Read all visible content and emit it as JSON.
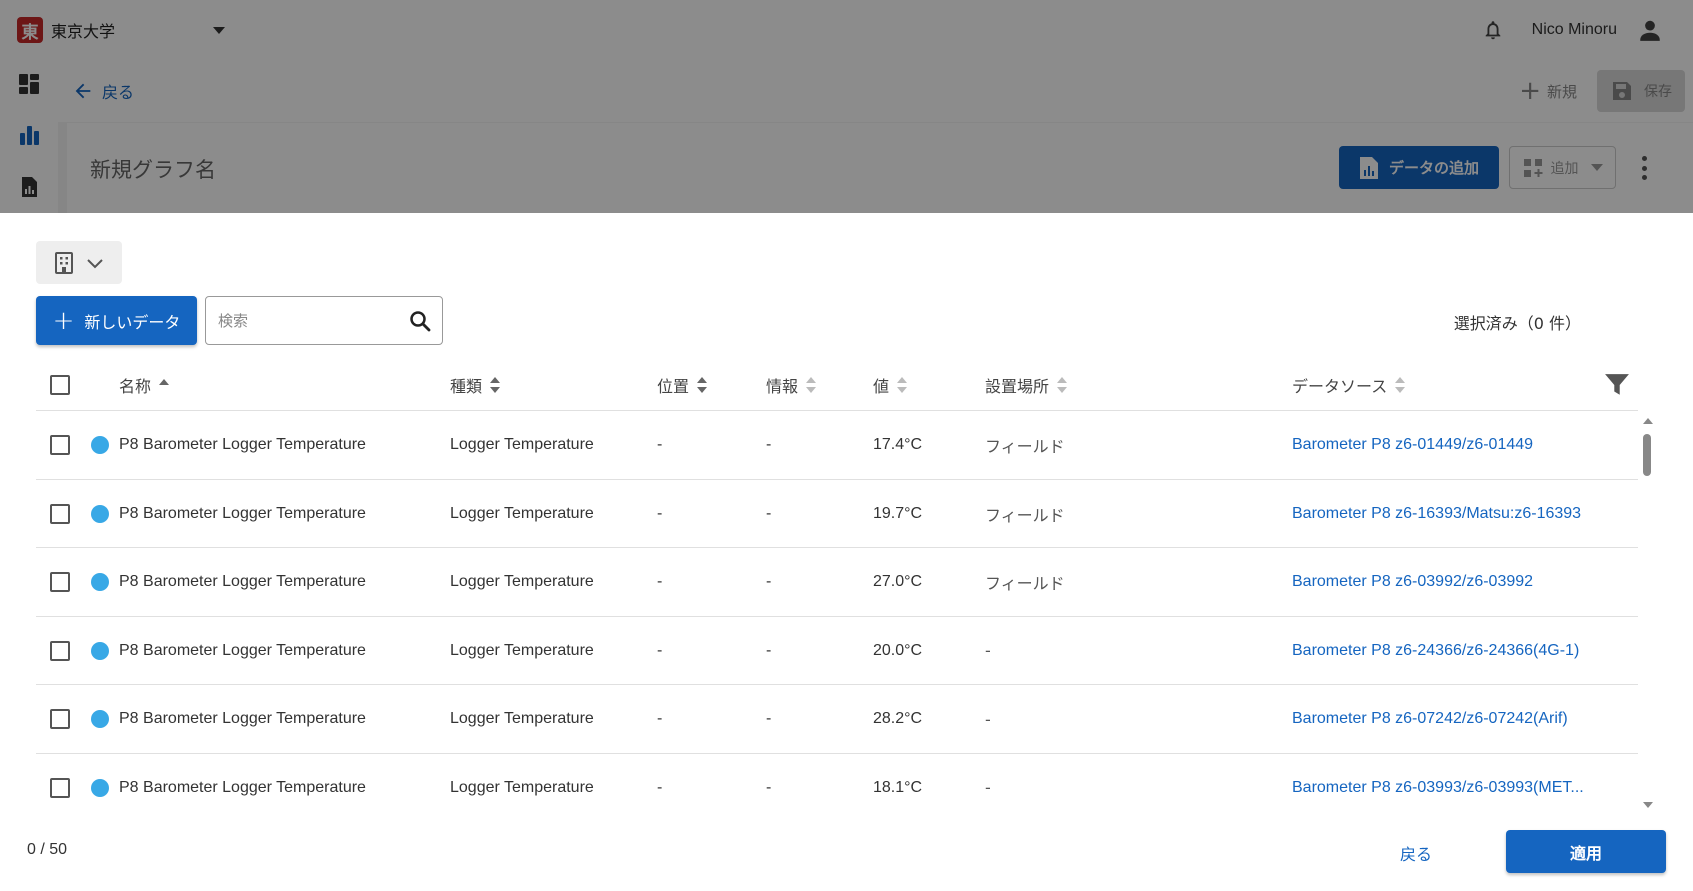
{
  "app": {
    "logo_char": "東",
    "org_name": "東京大学",
    "user_name": "Nico Minoru"
  },
  "subbar": {
    "back_label": "戻る",
    "new_label": "新規",
    "save_label": "保存"
  },
  "graph": {
    "name": "新規グラフ名",
    "add_data_label": "データの追加",
    "add_widget_label": "追加"
  },
  "dialog": {
    "new_data_label": "新しいデータ",
    "search_placeholder": "検索",
    "selected_count": "選択済み（0 件）",
    "columns": [
      "名称",
      "種類",
      "位置",
      "情報",
      "値",
      "設置場所",
      "データソース"
    ],
    "rows": [
      {
        "name": "P8 Barometer Logger Temperature",
        "type": "Logger Temperature",
        "position": "-",
        "info": "-",
        "value": "17.4°C",
        "location": "フィールド",
        "source": "Barometer P8 z6-01449/z6-01449"
      },
      {
        "name": "P8 Barometer Logger Temperature",
        "type": "Logger Temperature",
        "position": "-",
        "info": "-",
        "value": "19.7°C",
        "location": "フィールド",
        "source": "Barometer P8 z6-16393/Matsu:z6-16393"
      },
      {
        "name": "P8 Barometer Logger Temperature",
        "type": "Logger Temperature",
        "position": "-",
        "info": "-",
        "value": "27.0°C",
        "location": "フィールド",
        "source": "Barometer P8 z6-03992/z6-03992"
      },
      {
        "name": "P8 Barometer Logger Temperature",
        "type": "Logger Temperature",
        "position": "-",
        "info": "-",
        "value": "20.0°C",
        "location": "-",
        "source": "Barometer P8 z6-24366/z6-24366(4G-1)"
      },
      {
        "name": "P8 Barometer Logger Temperature",
        "type": "Logger Temperature",
        "position": "-",
        "info": "-",
        "value": "28.2°C",
        "location": "-",
        "source": "Barometer P8 z6-07242/z6-07242(Arif)"
      },
      {
        "name": "P8 Barometer Logger Temperature",
        "type": "Logger Temperature",
        "position": "-",
        "info": "-",
        "value": "18.1°C",
        "location": "-",
        "source": "Barometer P8 z6-03993/z6-03993(MET..."
      }
    ],
    "pager": "0 / 50",
    "back_label": "戻る",
    "apply_label": "適用"
  },
  "colors": {
    "primary": "#1565c0",
    "dot": "#38a8e6",
    "brand_red": "#c62828"
  }
}
